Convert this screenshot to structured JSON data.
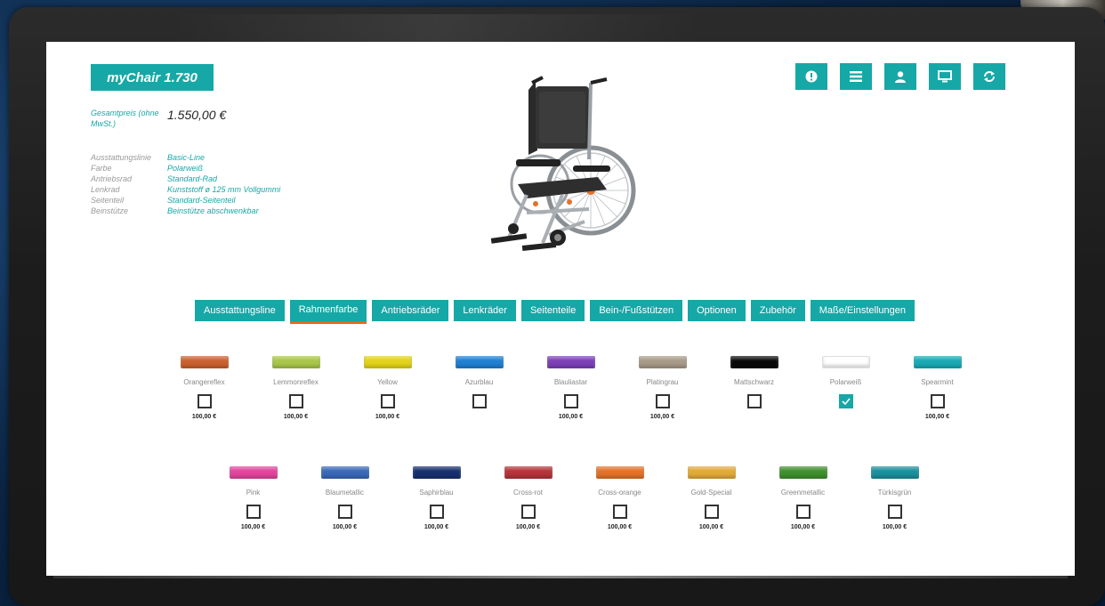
{
  "app": {
    "title": "myChair 1.730"
  },
  "price": {
    "label": "Gesamtpreis (ohne MwSt.)",
    "value": "1.550,00 €"
  },
  "specs": [
    {
      "key": "Ausstattungslinie",
      "value": "Basic-Line"
    },
    {
      "key": "Farbe",
      "value": "Polarweiß"
    },
    {
      "key": "Antriebsrad",
      "value": "Standard-Rad"
    },
    {
      "key": "Lenkrad",
      "value": "Kunststoff ø 125 mm Vollgummi"
    },
    {
      "key": "Seitenteil",
      "value": "Standard-Seitenteil"
    },
    {
      "key": "Beinstütze",
      "value": "Beinstütze abschwenkbar"
    }
  ],
  "toolbar": {
    "icons": [
      "info-icon",
      "menu-icon",
      "user-icon",
      "monitor-icon",
      "refresh-icon"
    ]
  },
  "tabs": [
    {
      "label": "Ausstattungsline",
      "active": false
    },
    {
      "label": "Rahmenfarbe",
      "active": true
    },
    {
      "label": "Antriebsräder",
      "active": false
    },
    {
      "label": "Lenkräder",
      "active": false
    },
    {
      "label": "Seitenteile",
      "active": false
    },
    {
      "label": "Bein-/Fußstützen",
      "active": false
    },
    {
      "label": "Optionen",
      "active": false
    },
    {
      "label": "Zubehör",
      "active": false
    },
    {
      "label": "Maße/Einstellungen",
      "active": false
    }
  ],
  "colors": {
    "row1": [
      {
        "name": "Orangereflex",
        "color": "#c9602e",
        "price": "100,00 €",
        "checked": false
      },
      {
        "name": "Lemmonreflex",
        "color": "#a9c64a",
        "price": "100,00 €",
        "checked": false
      },
      {
        "name": "Yellow",
        "color": "#e2d21b",
        "price": "100,00 €",
        "checked": false
      },
      {
        "name": "Azurblau",
        "color": "#1f7fd1",
        "price": "",
        "checked": false
      },
      {
        "name": "Blauliastar",
        "color": "#7c3fb6",
        "price": "100,00 €",
        "checked": false
      },
      {
        "name": "Platingrau",
        "color": "#a89a87",
        "price": "100,00 €",
        "checked": false
      },
      {
        "name": "Mattschwarz",
        "color": "#0a0a0a",
        "price": "",
        "checked": false
      },
      {
        "name": "Polarweiß",
        "color": "#ffffff",
        "price": "",
        "checked": true
      },
      {
        "name": "Spearmint",
        "color": "#1aa9b4",
        "price": "100,00 €",
        "checked": false
      }
    ],
    "row2": [
      {
        "name": "Pink",
        "color": "#e2449c",
        "price": "100,00 €",
        "checked": false
      },
      {
        "name": "Blaumetallic",
        "color": "#3a68b8",
        "price": "100,00 €",
        "checked": false
      },
      {
        "name": "Saphirblau",
        "color": "#172f6e",
        "price": "100,00 €",
        "checked": false
      },
      {
        "name": "Cross-rot",
        "color": "#b3343a",
        "price": "100,00 €",
        "checked": false
      },
      {
        "name": "Cross-orange",
        "color": "#e2722a",
        "price": "100,00 €",
        "checked": false
      },
      {
        "name": "Gold-Special",
        "color": "#e2a93a",
        "price": "100,00 €",
        "checked": false
      },
      {
        "name": "Greenmetallic",
        "color": "#3f8f2e",
        "price": "100,00 €",
        "checked": false
      },
      {
        "name": "Türkisgrün",
        "color": "#1b8f9c",
        "price": "100,00 €",
        "checked": false
      }
    ]
  }
}
